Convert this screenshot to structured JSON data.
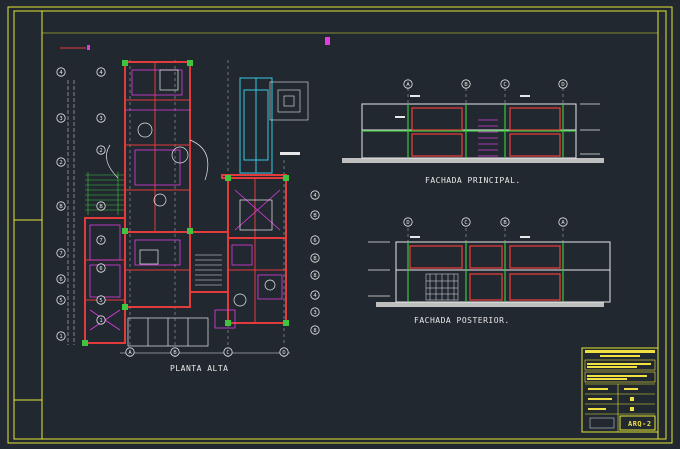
{
  "colors": {
    "background": "#212830",
    "frame": "#e6e632",
    "wall": "#e23b3b",
    "line": "#e8e8e8",
    "green": "#3ec43e",
    "cyan": "#38c8e0",
    "magenta": "#e03ce0",
    "yellow": "#f0e040"
  },
  "plan": {
    "title": "PLANTA ALTA",
    "left_axes": [
      "4",
      "3",
      "2",
      "B",
      "7",
      "6",
      "5",
      "1"
    ],
    "left_axes_inner": [
      "4",
      "3",
      "2",
      "B",
      "7",
      "6",
      "5",
      "1"
    ],
    "right_axes": [
      "4",
      "B",
      "6",
      "B",
      "8",
      "4",
      "3",
      "8"
    ],
    "bottom_axes": [
      "A",
      "B",
      "C",
      "D"
    ]
  },
  "front_elevation": {
    "title": "FACHADA PRINCIPAL.",
    "axes": [
      "A",
      "B",
      "C",
      "D"
    ]
  },
  "rear_elevation": {
    "title": "FACHADA POSTERIOR.",
    "axes": [
      "D",
      "C",
      "B",
      "A"
    ]
  },
  "title_block": {
    "sheet_id": "ARQ-2"
  }
}
